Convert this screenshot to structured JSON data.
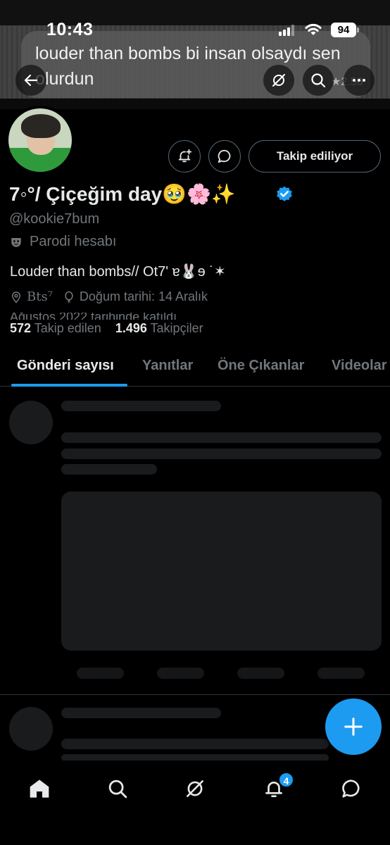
{
  "status_bar": {
    "time": "10:43",
    "battery": "94"
  },
  "banner_tweet": {
    "text": "louder than bombs bi insan olsaydı sen olurdun",
    "rate": "★2.56"
  },
  "header": {
    "back_icon": "arrow-left-icon",
    "grok_icon": "grok-icon",
    "search_icon": "search-icon",
    "more_icon": "more-icon"
  },
  "profile": {
    "display_name": "7◦°/ Çiçeğim day🥹🌸✨",
    "handle": "@kookie7bum",
    "parody_label": "Parodi hesabı",
    "bio": "Louder than bombs// Ot7' ɐ🐰ɘ ˙✶",
    "location": "Bts⁷",
    "birthday": "Doğum tarihi: 14 Aralık",
    "joined": "Ağustos 2022 tarihinde katıldı",
    "following_count": "572",
    "following_label": "Takip edilen",
    "followers_count": "1.496",
    "followers_label": "Takipçiler",
    "follow_button": "Takip ediliyor",
    "verified_color": "#1d9bf0"
  },
  "tabs": [
    {
      "label": "Gönderi sayısı",
      "active": true
    },
    {
      "label": "Yanıtlar",
      "active": false
    },
    {
      "label": "Öne Çıkanlar",
      "active": false
    },
    {
      "label": "Videolar",
      "active": false
    }
  ],
  "bottom_nav": {
    "items": [
      "home-icon",
      "search-icon",
      "grok-icon",
      "notifications-icon",
      "messages-icon"
    ],
    "notification_badge": "4"
  },
  "colors": {
    "accent": "#1d9bf0",
    "background": "#000000",
    "muted": "#71767b"
  }
}
